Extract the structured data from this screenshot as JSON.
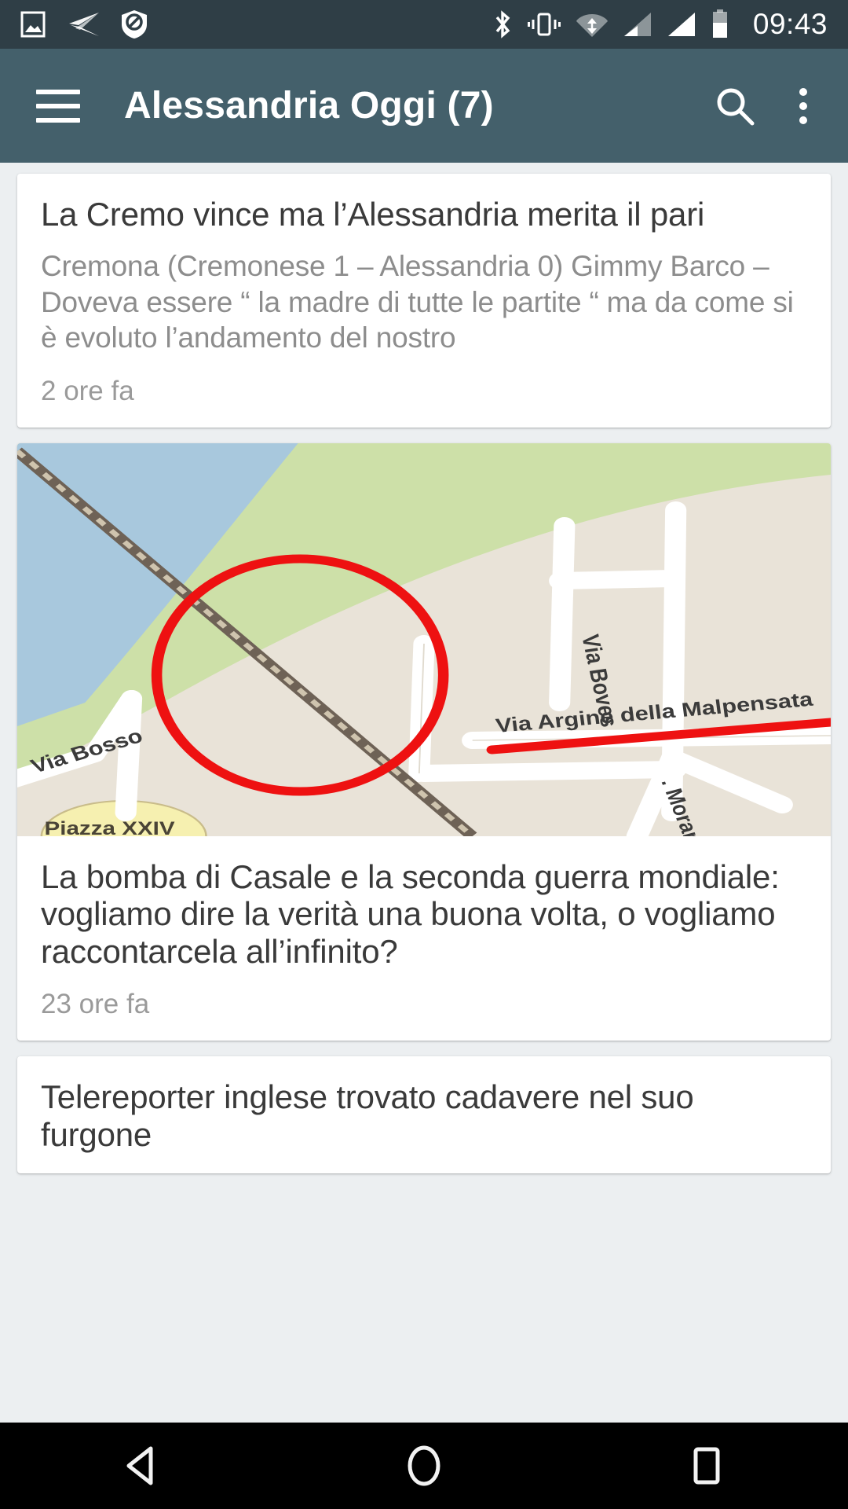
{
  "status_bar": {
    "time": "09:43",
    "left_icons": [
      {
        "name": "screenshot-icon",
        "label": "screenshot"
      },
      {
        "name": "telegram-icon",
        "label": "telegram"
      },
      {
        "name": "shield-block-icon",
        "label": "blocker"
      }
    ],
    "right_icons": [
      {
        "name": "bluetooth-icon",
        "label": "bluetooth"
      },
      {
        "name": "vibrate-icon",
        "label": "vibrate"
      },
      {
        "name": "wifi-icon",
        "label": "wifi"
      },
      {
        "name": "signal-sim1-icon",
        "label": "signal 1"
      },
      {
        "name": "signal-sim2-icon",
        "label": "signal 2"
      },
      {
        "name": "battery-icon",
        "label": "battery"
      }
    ],
    "battery_level": 60
  },
  "app_bar": {
    "menu_label": "menu",
    "title": "Alessandria Oggi (7)",
    "search_label": "search",
    "overflow_label": "more options"
  },
  "feed": {
    "cards": [
      {
        "title": "La Cremo vince ma l’Alessandria merita il pari",
        "snippet": "Cremona (Cremonese 1 – Alessandria 0) Gimmy Barco –  Doveva essere “ la madre di tutte le partite “ ma  da come si è evoluto l’andamento del nostro",
        "time": "2 ore fa",
        "has_image": false
      },
      {
        "title": "La bomba di Casale e la seconda guerra mondiale: vogliamo dire la verità una buona volta, o vogliamo raccontarcela all’infinito?",
        "snippet": "",
        "time": "23 ore fa",
        "has_image": true,
        "image": {
          "name": "map-thumbnail",
          "labels": [
            "Via Bosso",
            "Via Boves",
            "Via  Argine della Malpensata",
            "Morano",
            "Piazza XXIV"
          ],
          "colors": {
            "water": "#a8c8dd",
            "green": "#cde0a8",
            "land": "#e9e3d8",
            "road": "#ffffff",
            "annotation": "#ee1111",
            "yellow_area": "#f6f0b0"
          }
        }
      },
      {
        "title": "Telereporter inglese trovato cadavere nel suo furgone",
        "snippet": "",
        "time": "",
        "has_image": false
      }
    ]
  },
  "nav_bar": {
    "back_label": "back",
    "home_label": "home",
    "recents_label": "recent apps"
  }
}
